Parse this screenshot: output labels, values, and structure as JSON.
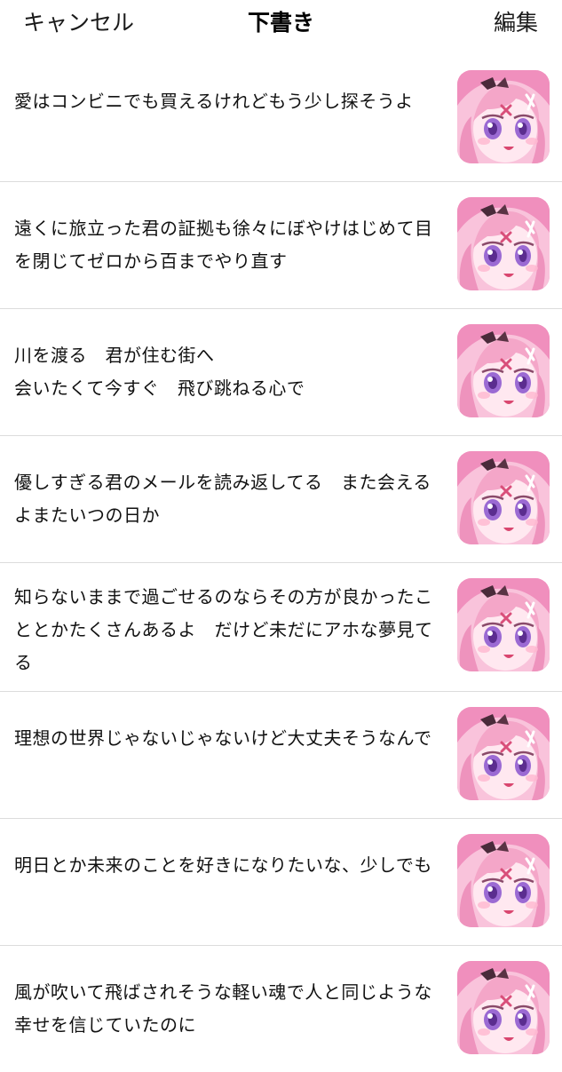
{
  "header": {
    "cancel_label": "キャンセル",
    "title": "下書き",
    "edit_label": "編集"
  },
  "drafts": [
    {
      "text": "愛はコンビニでも買えるけれどもう少し探そうよ"
    },
    {
      "text": "遠くに旅立った君の証拠も徐々にぼやけはじめて目を閉じてゼロから百までやり直す"
    },
    {
      "text": "川を渡る　君が住む街へ\n会いたくて今すぐ　飛び跳ねる心で"
    },
    {
      "text": "優しすぎる君のメールを読み返してる　また会えるよまたいつの日か"
    },
    {
      "text": "知らないままで過ごせるのならその方が良かったこととかたくさんあるよ　だけど未だにアホな夢見てる"
    },
    {
      "text": "理想の世界じゃないじゃないけど大丈夫そうなんで"
    },
    {
      "text": "明日とか未来のことを好きになりたいな、少しでも"
    },
    {
      "text": "風が吹いて飛ばされそうな軽い魂で人と同じような幸せを信じていたのに"
    }
  ],
  "thumbnail": {
    "icon": "pink-haired-anime-avatar",
    "colors": {
      "hair": "#f4a6c8",
      "skin": "#ffe6ee",
      "eyes": "#9b6ad3",
      "ribbon": "#4a2a3a"
    }
  }
}
